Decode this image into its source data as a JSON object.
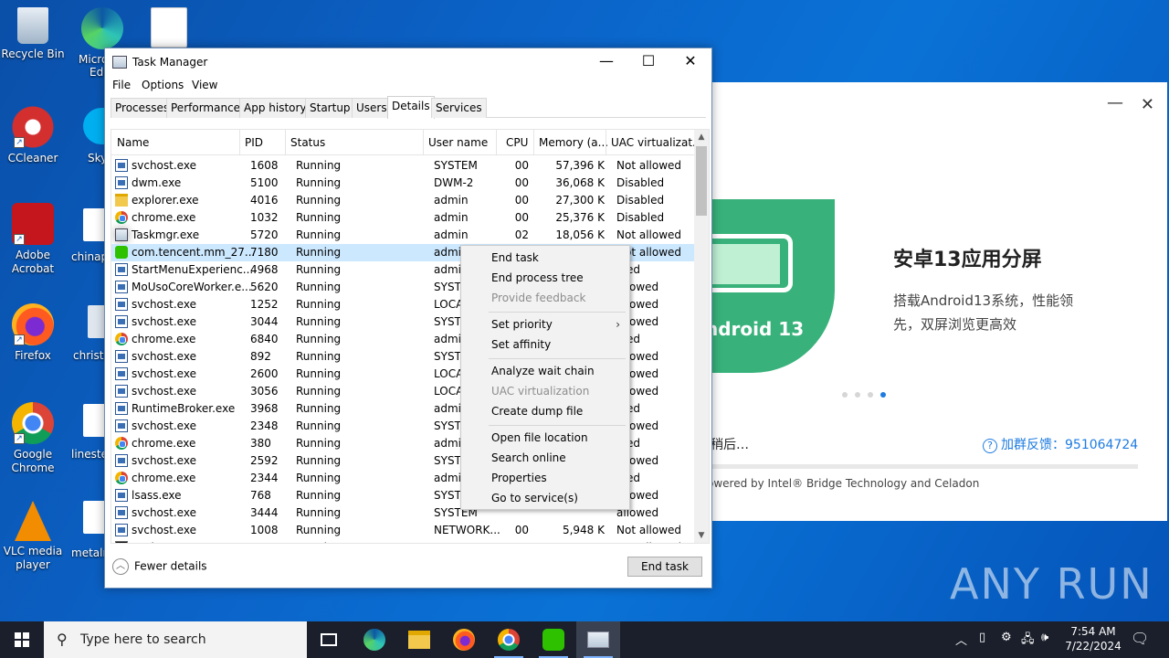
{
  "desktop": {
    "icons": [
      {
        "label": "Recycle Bin"
      },
      {
        "label": "CCleaner"
      },
      {
        "label": "Adobe Acrobat"
      },
      {
        "label": "Firefox"
      },
      {
        "label": "Google Chrome"
      },
      {
        "label": "VLC media player"
      }
    ],
    "partial_labels": [
      "Micro",
      "Edg",
      "Sky",
      "chinap",
      "christi",
      "lineste",
      "metaln"
    ]
  },
  "promo": {
    "banner_text": "ndroid 13",
    "title": "安卓13应用分屏",
    "description": "搭载Android13系统，性能领先，双屏浏览更高效",
    "loading_text": "稍后…",
    "feedback_text": "加群反馈：951064724",
    "feedback_icon": "?",
    "powered_text": "owered by Intel® Bridge Technology and Celadon"
  },
  "taskmanager": {
    "title": "Task Manager",
    "menu": [
      "File",
      "Options",
      "View"
    ],
    "tabs": [
      "Processes",
      "Performance",
      "App history",
      "Startup",
      "Users",
      "Details",
      "Services"
    ],
    "active_tab": "Details",
    "columns": [
      "Name",
      "PID",
      "Status",
      "User name",
      "CPU",
      "Memory (a...",
      "UAC virtualizat..."
    ],
    "rows": [
      {
        "icon": "svc",
        "name": "svchost.exe",
        "pid": "1608",
        "status": "Running",
        "user": "SYSTEM",
        "cpu": "00",
        "mem": "57,396 K",
        "uac": "Not allowed"
      },
      {
        "icon": "svc",
        "name": "dwm.exe",
        "pid": "5100",
        "status": "Running",
        "user": "DWM-2",
        "cpu": "00",
        "mem": "36,068 K",
        "uac": "Disabled"
      },
      {
        "icon": "folder",
        "name": "explorer.exe",
        "pid": "4016",
        "status": "Running",
        "user": "admin",
        "cpu": "00",
        "mem": "27,300 K",
        "uac": "Disabled"
      },
      {
        "icon": "chrome",
        "name": "chrome.exe",
        "pid": "1032",
        "status": "Running",
        "user": "admin",
        "cpu": "00",
        "mem": "25,376 K",
        "uac": "Disabled"
      },
      {
        "icon": "tm",
        "name": "Taskmgr.exe",
        "pid": "5720",
        "status": "Running",
        "user": "admin",
        "cpu": "02",
        "mem": "18,056 K",
        "uac": "Not allowed"
      },
      {
        "icon": "wechat",
        "name": "com.tencent.mm_27...",
        "pid": "7180",
        "status": "Running",
        "user": "admin",
        "cpu": "",
        "mem": "",
        "uac": "Not allowed"
      },
      {
        "icon": "svc",
        "name": "StartMenuExperienc...",
        "pid": "4968",
        "status": "Running",
        "user": "admin",
        "cpu": "",
        "mem": "",
        "uac": "bled"
      },
      {
        "icon": "svc",
        "name": "MoUsoCoreWorker.e...",
        "pid": "5620",
        "status": "Running",
        "user": "SYSTEM",
        "cpu": "",
        "mem": "",
        "uac": "allowed"
      },
      {
        "icon": "svc",
        "name": "svchost.exe",
        "pid": "1252",
        "status": "Running",
        "user": "LOCAL",
        "cpu": "",
        "mem": "",
        "uac": "allowed"
      },
      {
        "icon": "svc",
        "name": "svchost.exe",
        "pid": "3044",
        "status": "Running",
        "user": "SYSTEM",
        "cpu": "",
        "mem": "",
        "uac": "allowed"
      },
      {
        "icon": "chrome",
        "name": "chrome.exe",
        "pid": "6840",
        "status": "Running",
        "user": "admin",
        "cpu": "",
        "mem": "",
        "uac": "bled"
      },
      {
        "icon": "svc",
        "name": "svchost.exe",
        "pid": "892",
        "status": "Running",
        "user": "SYSTEM",
        "cpu": "",
        "mem": "",
        "uac": "allowed"
      },
      {
        "icon": "svc",
        "name": "svchost.exe",
        "pid": "2600",
        "status": "Running",
        "user": "LOCAL",
        "cpu": "",
        "mem": "",
        "uac": "allowed"
      },
      {
        "icon": "svc",
        "name": "svchost.exe",
        "pid": "3056",
        "status": "Running",
        "user": "LOCAL",
        "cpu": "",
        "mem": "",
        "uac": "allowed"
      },
      {
        "icon": "svc",
        "name": "RuntimeBroker.exe",
        "pid": "3968",
        "status": "Running",
        "user": "admin",
        "cpu": "",
        "mem": "",
        "uac": "bled"
      },
      {
        "icon": "svc",
        "name": "svchost.exe",
        "pid": "2348",
        "status": "Running",
        "user": "SYSTEM",
        "cpu": "",
        "mem": "",
        "uac": "allowed"
      },
      {
        "icon": "chrome",
        "name": "chrome.exe",
        "pid": "380",
        "status": "Running",
        "user": "admin",
        "cpu": "",
        "mem": "",
        "uac": "bled"
      },
      {
        "icon": "svc",
        "name": "svchost.exe",
        "pid": "2592",
        "status": "Running",
        "user": "SYSTEM",
        "cpu": "",
        "mem": "",
        "uac": "allowed"
      },
      {
        "icon": "chrome",
        "name": "chrome.exe",
        "pid": "2344",
        "status": "Running",
        "user": "admin",
        "cpu": "",
        "mem": "",
        "uac": "bled"
      },
      {
        "icon": "svc",
        "name": "lsass.exe",
        "pid": "768",
        "status": "Running",
        "user": "SYSTEM",
        "cpu": "",
        "mem": "",
        "uac": "allowed"
      },
      {
        "icon": "svc",
        "name": "svchost.exe",
        "pid": "3444",
        "status": "Running",
        "user": "SYSTEM",
        "cpu": "",
        "mem": "",
        "uac": "allowed"
      },
      {
        "icon": "svc",
        "name": "svchost.exe",
        "pid": "1008",
        "status": "Running",
        "user": "NETWORK...",
        "cpu": "00",
        "mem": "5,948 K",
        "uac": "Not allowed"
      },
      {
        "icon": "cmd",
        "name": "conhost.exe",
        "pid": "8160",
        "status": "Running",
        "user": "SYSTEM",
        "cpu": "00",
        "mem": "5,876 K",
        "uac": "Not allowed"
      }
    ],
    "selected_row": 5,
    "fewer_details": "Fewer details",
    "end_task_button": "End task"
  },
  "context_menu": {
    "items": [
      {
        "label": "End task",
        "enabled": true
      },
      {
        "label": "End process tree",
        "enabled": true
      },
      {
        "label": "Provide feedback",
        "enabled": false
      },
      {
        "label": "Set priority",
        "enabled": true,
        "submenu": true
      },
      {
        "label": "Set affinity",
        "enabled": true
      },
      {
        "label": "Analyze wait chain",
        "enabled": true
      },
      {
        "label": "UAC virtualization",
        "enabled": false
      },
      {
        "label": "Create dump file",
        "enabled": true
      },
      {
        "label": "Open file location",
        "enabled": true
      },
      {
        "label": "Search online",
        "enabled": true
      },
      {
        "label": "Properties",
        "enabled": true
      },
      {
        "label": "Go to service(s)",
        "enabled": true
      }
    ]
  },
  "watermark": "ANY RUN",
  "taskbar": {
    "search_placeholder": "Type here to search",
    "time": "7:54 AM",
    "date": "7/22/2024"
  }
}
